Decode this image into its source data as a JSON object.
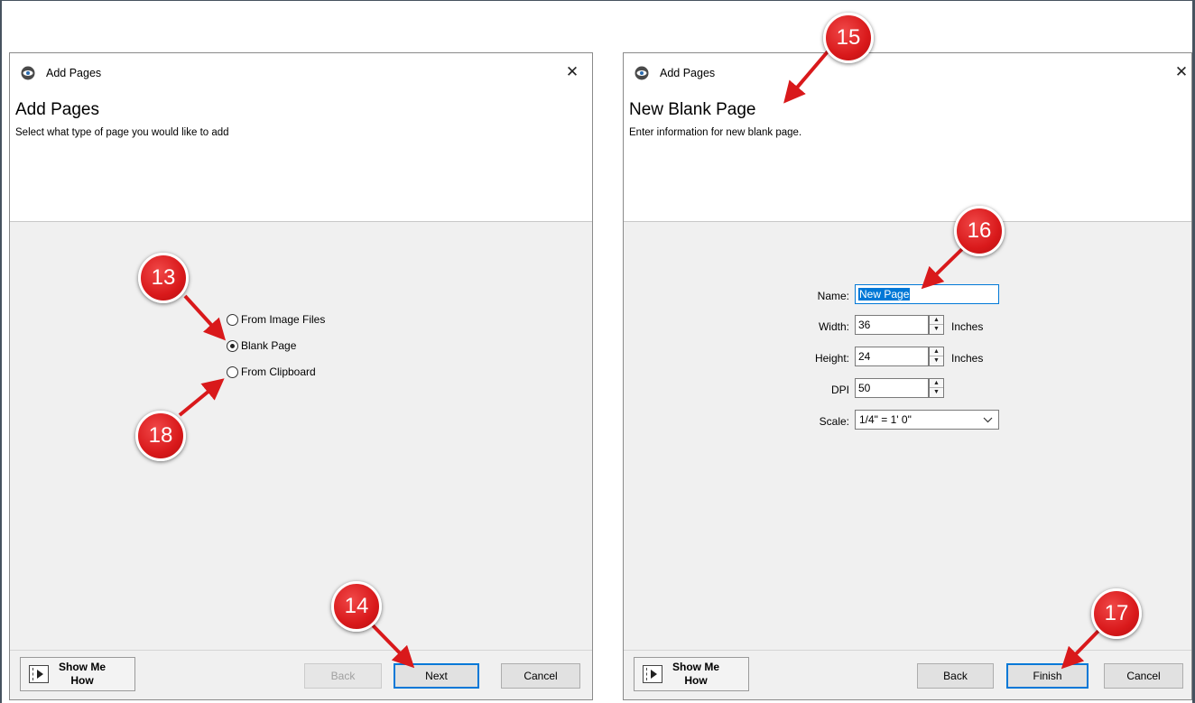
{
  "left_dialog": {
    "title": "Add Pages",
    "close_glyph": "✕",
    "heading": "Add Pages",
    "subheading": "Select what type of page you would like to add",
    "options": [
      {
        "label": "From Image Files",
        "checked": false
      },
      {
        "label": "Blank Page",
        "checked": true
      },
      {
        "label": "From Clipboard",
        "checked": false
      }
    ],
    "show_me_line1": "Show Me",
    "show_me_line2": "How",
    "back_label": "Back",
    "next_label": "Next",
    "cancel_label": "Cancel"
  },
  "right_dialog": {
    "title": "Add Pages",
    "close_glyph": "✕",
    "heading": "New Blank Page",
    "subheading": "Enter information for new blank page.",
    "name_label": "Name:",
    "name_value": "New Page",
    "width_label": "Width:",
    "width_value": "36",
    "height_label": "Height:",
    "height_value": "24",
    "dpi_label": "DPI",
    "dpi_value": "50",
    "scale_label": "Scale:",
    "scale_value": "1/4\" = 1' 0\"",
    "unit_label": "Inches",
    "show_me_line1": "Show Me",
    "show_me_line2": "How",
    "back_label": "Back",
    "finish_label": "Finish",
    "cancel_label": "Cancel"
  },
  "callouts": {
    "c13": "13",
    "c14": "14",
    "c15": "15",
    "c16": "16",
    "c17": "17",
    "c18": "18"
  },
  "colors": {
    "callout": "#d9191b",
    "accent": "#0078d7",
    "dialog_bg": "#f0f0f0"
  },
  "icons": [
    "app-eye-icon",
    "close-icon",
    "show-me-how-icon",
    "spinner-up-icon",
    "spinner-down-icon",
    "chevron-down-icon"
  ]
}
